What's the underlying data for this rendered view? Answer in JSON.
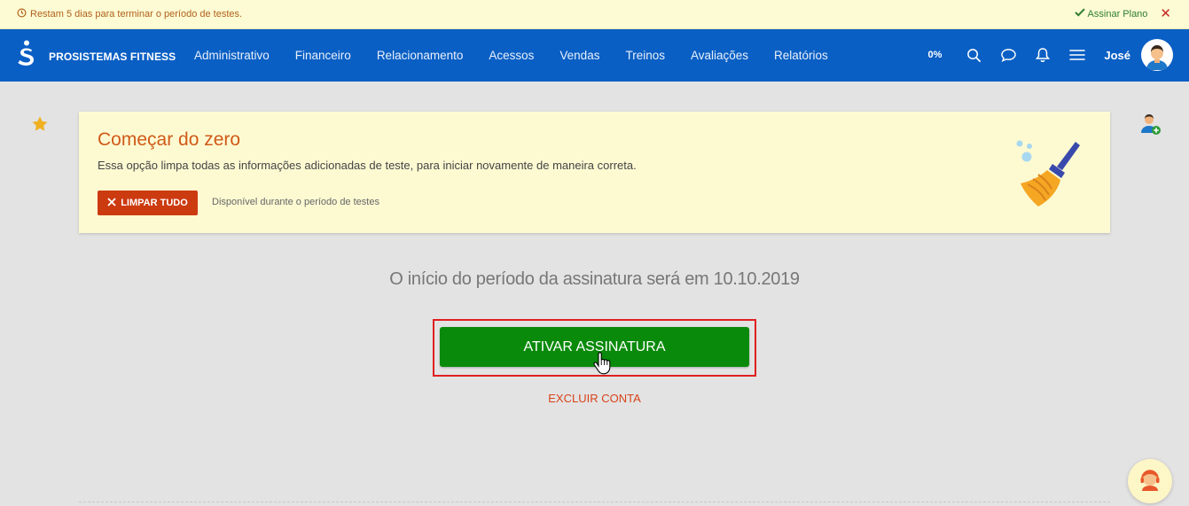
{
  "trial_bar": {
    "message": "Restam 5 dias para terminar o período de testes.",
    "sign_plan_label": "Assinar Plano",
    "close_label": "✕"
  },
  "navbar": {
    "brand": "PROSISTEMAS FITNESS",
    "menu": [
      "Administrativo",
      "Financeiro",
      "Relacionamento",
      "Acessos",
      "Vendas",
      "Treinos",
      "Avaliações",
      "Relatórios"
    ],
    "progress": "0%",
    "user_name": "José"
  },
  "reset_card": {
    "title": "Começar do zero",
    "description": "Essa opção limpa todas as informações adicionadas de teste, para iniciar novamente de maneira correta.",
    "clear_button_label": "LIMPAR TUDO",
    "note": "Disponível durante o período de testes"
  },
  "main": {
    "start_text": "O início do período da assinatura será em 10.10.2019",
    "activate_button_label": "ATIVAR ASSINATURA",
    "delete_account_label": "EXCLUIR CONTA"
  },
  "colors": {
    "nav_blue": "#0a5fc4",
    "trial_bg": "#fdfbd3",
    "accent_orange": "#d05a18",
    "activate_green": "#0a8a0a",
    "highlight_red": "#e02020"
  }
}
